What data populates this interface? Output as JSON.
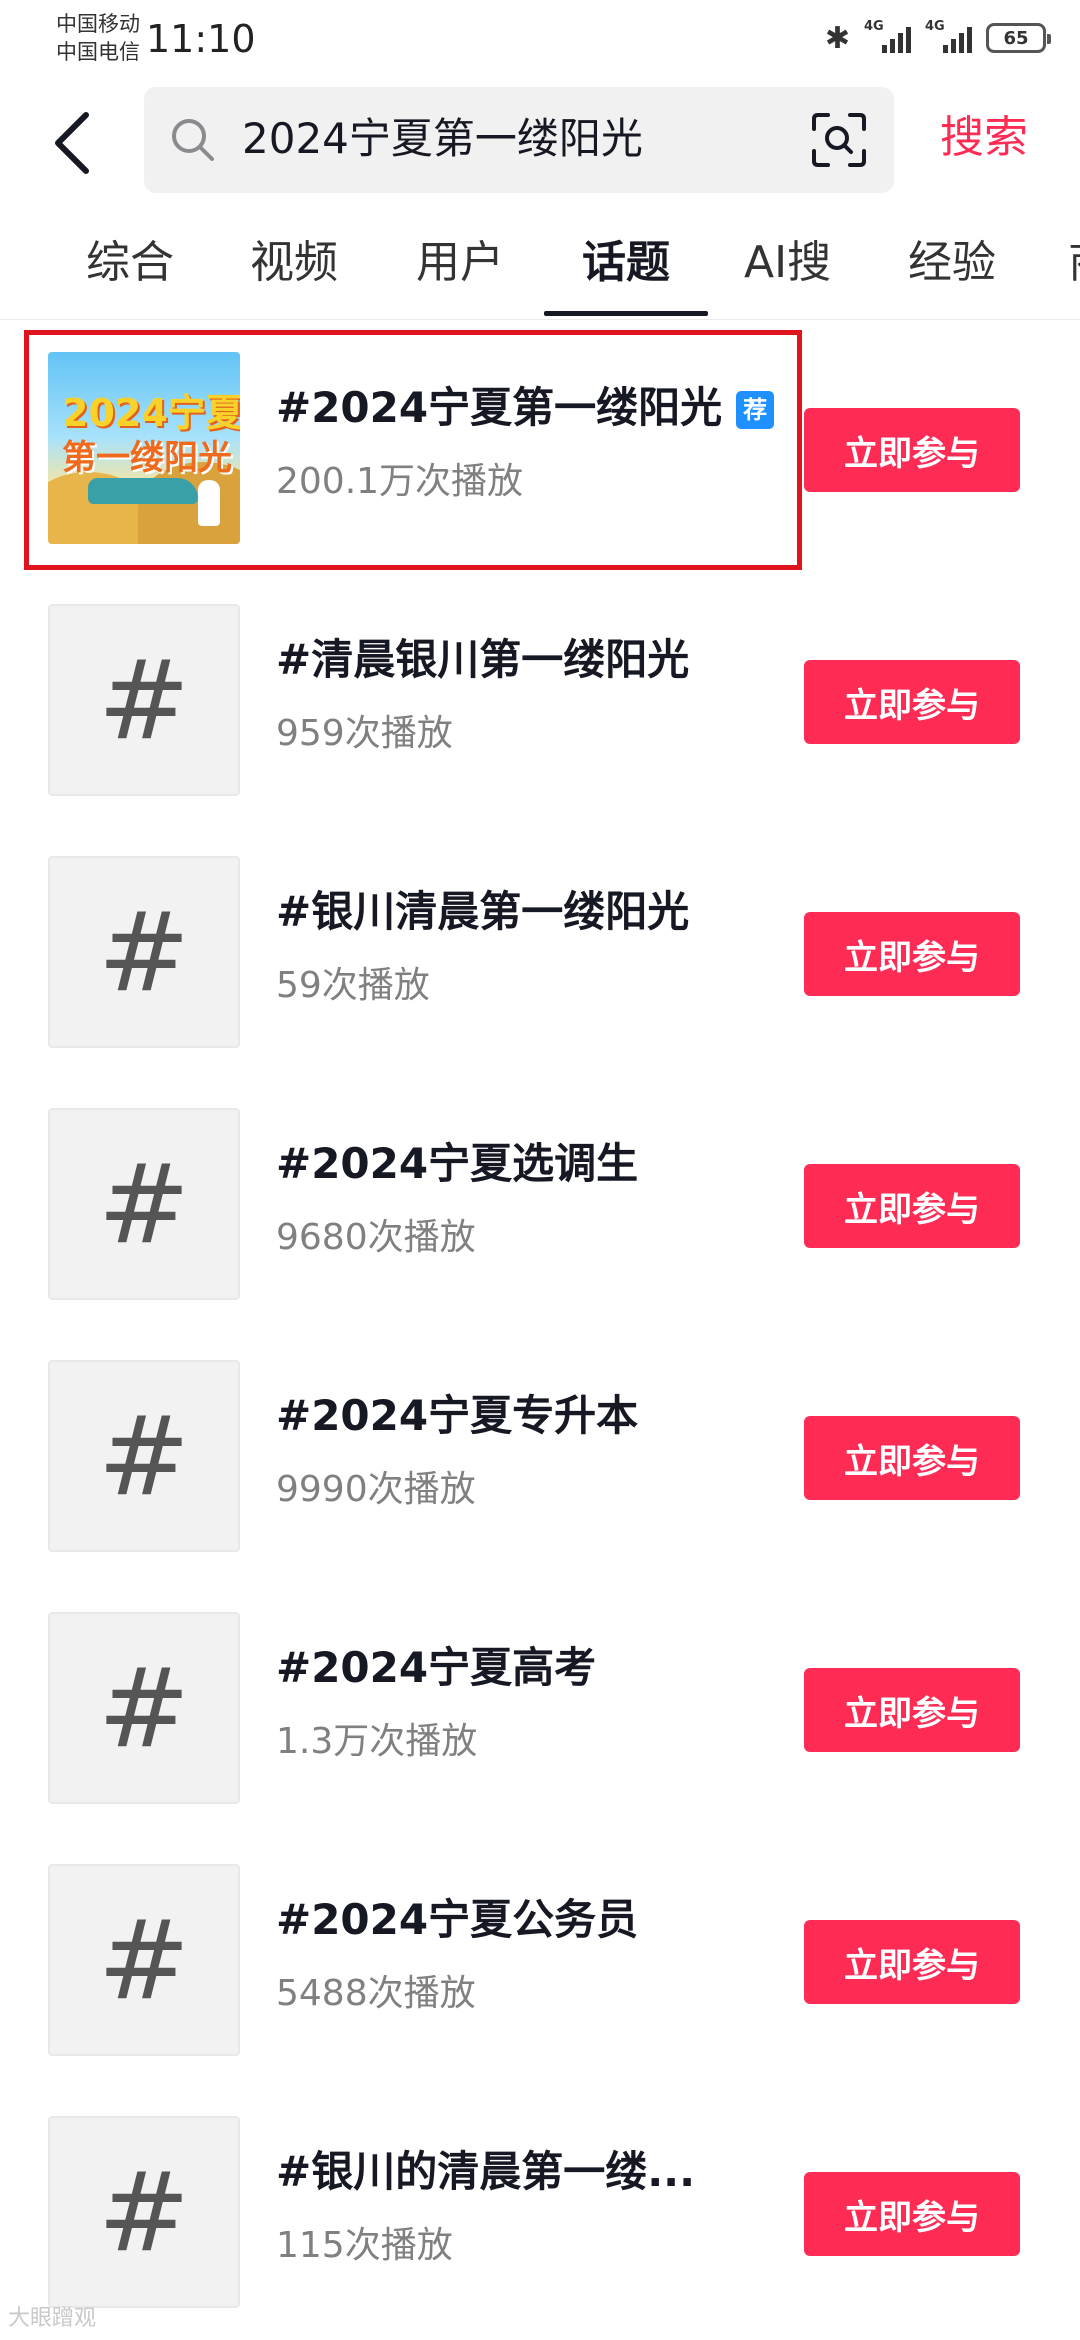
{
  "status_bar": {
    "carrier_1": "中国移动",
    "carrier_2": "中国电信",
    "time": "11:10",
    "signal_label_1": "4G",
    "signal_label_2": "4G",
    "battery": "65"
  },
  "search": {
    "query": "2024宁夏第一缕阳光",
    "button_label": "搜索"
  },
  "tabs": [
    {
      "label": "综合"
    },
    {
      "label": "视频"
    },
    {
      "label": "用户"
    },
    {
      "label": "话题"
    },
    {
      "label": "AI搜"
    },
    {
      "label": "经验"
    },
    {
      "label": "商"
    }
  ],
  "active_tab": "话题",
  "topics": [
    {
      "title": "#2024宁夏第一缕阳光",
      "plays": "200.1万次播放",
      "badge": "荐",
      "join_label": "立即参与",
      "thumb_text_1": "2024宁夏",
      "thumb_text_2": "第一缕阳光"
    },
    {
      "title": "#清晨银川第一缕阳光",
      "plays": "959次播放",
      "join_label": "立即参与"
    },
    {
      "title": "#银川清晨第一缕阳光",
      "plays": "59次播放",
      "join_label": "立即参与"
    },
    {
      "title": "#2024宁夏选调生",
      "plays": "9680次播放",
      "join_label": "立即参与"
    },
    {
      "title": "#2024宁夏专升本",
      "plays": "9990次播放",
      "join_label": "立即参与"
    },
    {
      "title": "#2024宁夏高考",
      "plays": "1.3万次播放",
      "join_label": "立即参与"
    },
    {
      "title": "#2024宁夏公务员",
      "plays": "5488次播放",
      "join_label": "立即参与"
    },
    {
      "title": "#银川的清晨第一缕...",
      "plays": "115次播放",
      "join_label": "立即参与"
    }
  ],
  "placeholder_glyph": "#",
  "watermark": "大眼蹭观",
  "icons": {
    "back": "back-arrow-icon",
    "search": "search-icon",
    "scan": "image-search-icon",
    "bluetooth": "bluetooth-icon",
    "signal": "signal-icon",
    "battery": "battery-icon"
  },
  "colors": {
    "accent": "#fe2c55",
    "badge": "#1e90ff",
    "highlight": "#e0141e"
  }
}
